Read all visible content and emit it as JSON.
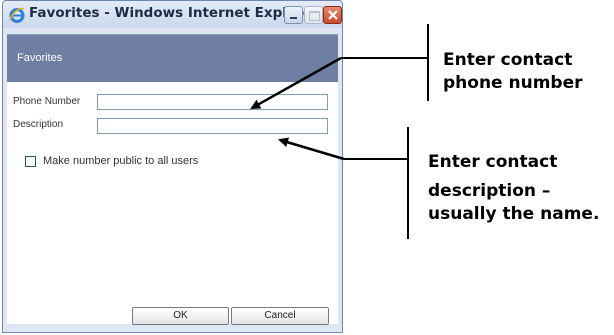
{
  "window": {
    "title": "Favorites - Windows Internet Explorer",
    "icon": "ie-icon",
    "controls": [
      "minimize-icon",
      "maximize-icon",
      "close-icon"
    ]
  },
  "header": {
    "title": "Favorites"
  },
  "form": {
    "phone_label": "Phone Number",
    "phone_value": "",
    "description_label": "Description",
    "description_value": "",
    "public_checkbox_label": "Make number public to all users",
    "public_checked": false
  },
  "buttons": {
    "ok": "OK",
    "cancel": "Cancel"
  },
  "annotations": {
    "phone_line1": "Enter contact",
    "phone_line2": "phone number",
    "desc_line1": "Enter contact",
    "desc_line2": "description –",
    "desc_line3": "usually the name."
  },
  "colors": {
    "header_bg": "#6f7fa3",
    "window_border": "#6f87b3",
    "close_button": "#c94a2c"
  }
}
